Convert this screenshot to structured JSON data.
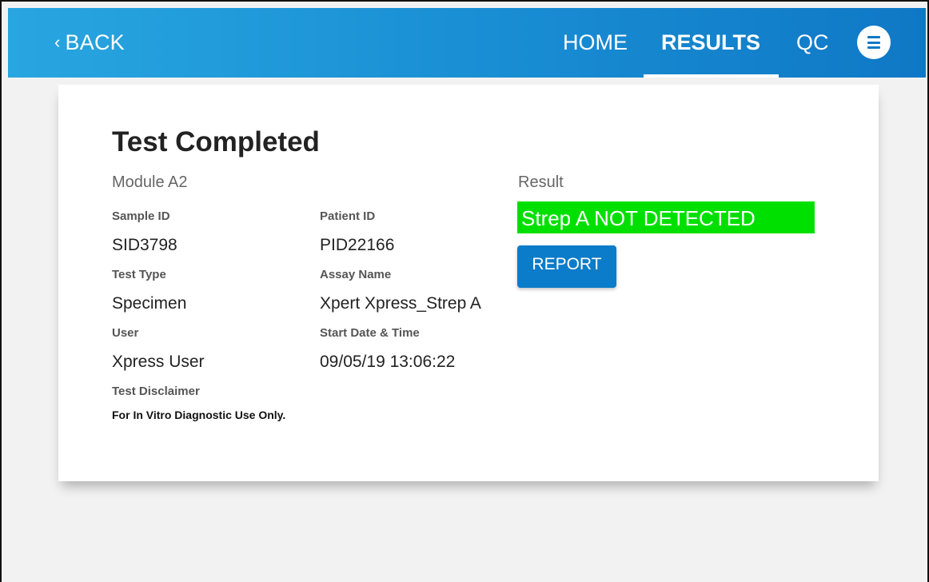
{
  "header": {
    "back_label": "BACK",
    "nav": {
      "home": "HOME",
      "results": "RESULTS",
      "qc": "QC"
    },
    "active_tab": "RESULTS",
    "accent_color": "#1a8fd4"
  },
  "card": {
    "title": "Test Completed",
    "module": "Module A2",
    "fields": {
      "sample_id_label": "Sample ID",
      "sample_id": "SID3798",
      "patient_id_label": "Patient ID",
      "patient_id": "PID22166",
      "test_type_label": "Test Type",
      "test_type": "Specimen",
      "assay_name_label": "Assay Name",
      "assay_name": "Xpert Xpress_Strep A",
      "user_label": "User",
      "user": "Xpress User",
      "start_label": "Start Date & Time",
      "start": "09/05/19 13:06:22",
      "disclaimer_label": "Test Disclaimer",
      "disclaimer": "For In Vitro Diagnostic Use Only."
    },
    "result": {
      "label": "Result",
      "value": "Strep A NOT DETECTED",
      "color": "#00e000"
    },
    "report_button": "REPORT"
  }
}
